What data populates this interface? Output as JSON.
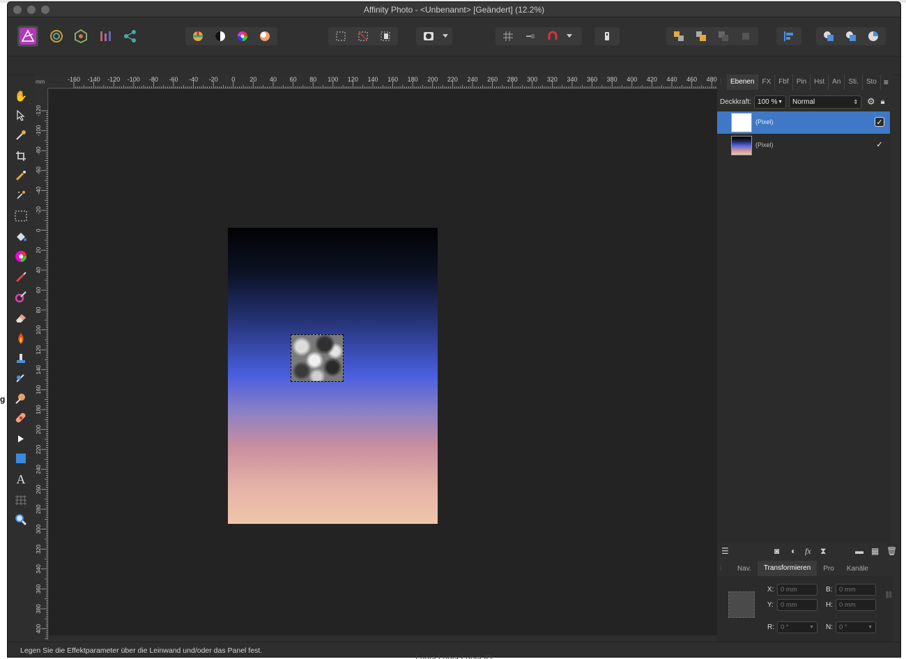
{
  "window": {
    "title": "Affinity Photo - <Unbenannt> [Geändert] (12.2%)"
  },
  "personas": [
    {
      "name": "photo-persona-icon",
      "active": true
    },
    {
      "name": "liquify-persona-icon",
      "active": false
    },
    {
      "name": "develop-persona-icon",
      "active": false
    },
    {
      "name": "tone-mapping-persona-icon",
      "active": false
    },
    {
      "name": "export-persona-icon",
      "active": false
    }
  ],
  "ruler": {
    "unit": "mm",
    "h_ticks": [
      "-160",
      "-140",
      "-120",
      "-100",
      "-80",
      "-60",
      "-40",
      "-20",
      "0",
      "20",
      "40",
      "60",
      "80",
      "100",
      "120",
      "140",
      "160",
      "180",
      "200",
      "220",
      "240",
      "260",
      "280",
      "300",
      "320",
      "340",
      "360",
      "380",
      "400",
      "420",
      "440",
      "460",
      "480"
    ],
    "v_ticks": [
      "-120",
      "-100",
      "-80",
      "-60",
      "-40",
      "-20",
      "0",
      "20",
      "40",
      "60",
      "80",
      "100",
      "120",
      "140",
      "160",
      "180",
      "200",
      "220",
      "240",
      "260",
      "280",
      "300",
      "320",
      "340",
      "360",
      "380",
      "400"
    ]
  },
  "layers_panel": {
    "tabs": [
      "Ebenen",
      "FX",
      "Fbf",
      "Pin",
      "Hst",
      "An",
      "Sti.",
      "Sto"
    ],
    "opacity_label": "Deckkraft:",
    "opacity_value": "100 %",
    "blend_mode": "Normal",
    "layers": [
      {
        "name": "(Pixel)",
        "selected": true,
        "visible": "✓"
      },
      {
        "name": "(Pixel)",
        "selected": false,
        "visible": "✓"
      }
    ]
  },
  "transform_panel": {
    "tabs": [
      "Nav.",
      "Transformieren",
      "Pro",
      "Kanäle"
    ],
    "x_label": "X:",
    "x_value": "0 mm",
    "y_label": "Y:",
    "y_value": "0 mm",
    "b_label": "B:",
    "b_value": "0 mm",
    "h_label": "H:",
    "h_value": "0 mm",
    "r_label": "R:",
    "r_value": "0 °",
    "n_label": "N:",
    "n_value": "0 °"
  },
  "status": {
    "text": "Legen Sie die Effektparameter über die Leinwand und/oder das Panel fest."
  },
  "desktop": {
    "left_fragment": "g",
    "bottom_fragment": "Lunia Lunia Lunia ID"
  },
  "colors": {
    "accent": "#3e78c6",
    "canvas_bg": "#232323",
    "panel_bg": "#2e2e2e"
  }
}
